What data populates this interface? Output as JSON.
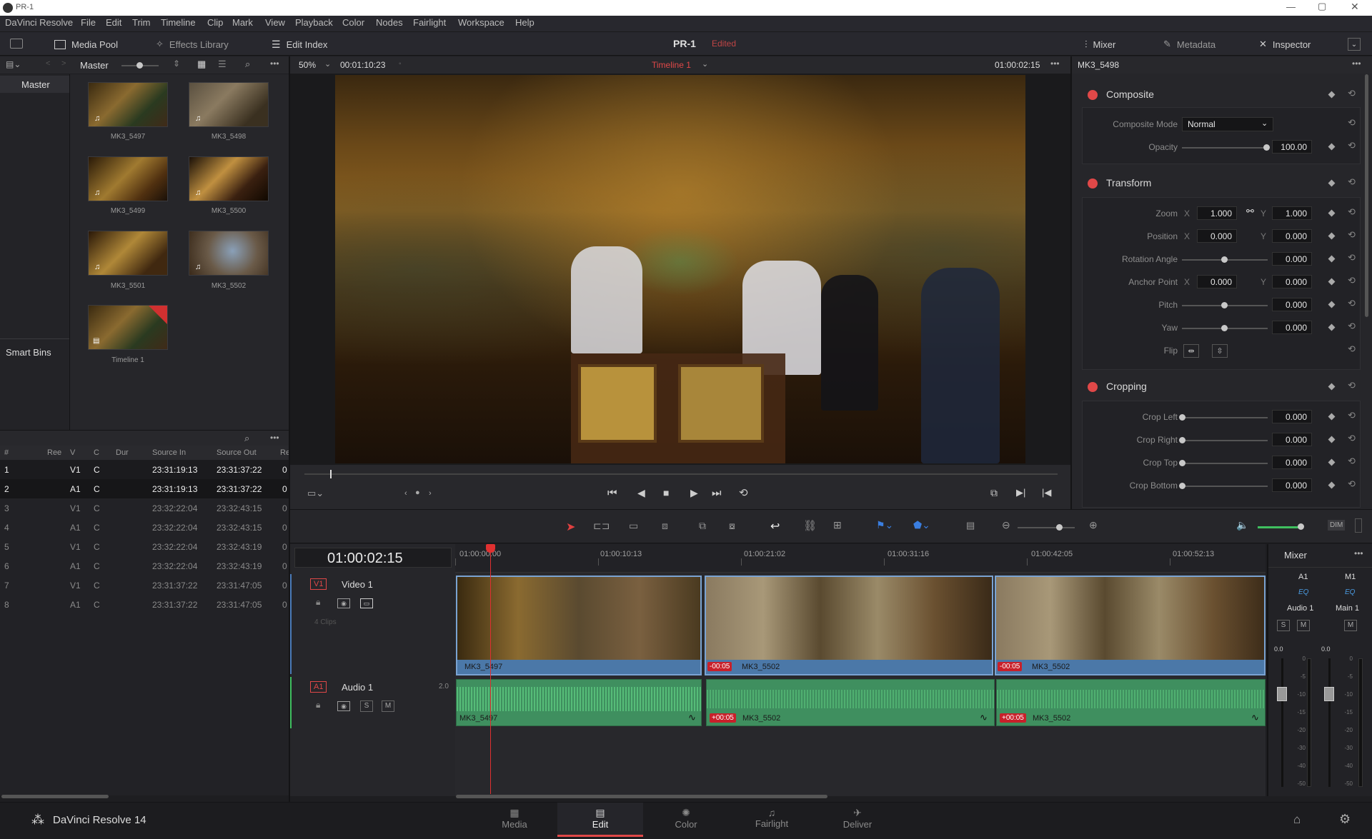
{
  "window": {
    "title": "PR-1"
  },
  "menu": [
    "DaVinci Resolve",
    "File",
    "Edit",
    "Trim",
    "Timeline",
    "Clip",
    "Mark",
    "View",
    "Playback",
    "Color",
    "Nodes",
    "Fairlight",
    "Workspace",
    "Help"
  ],
  "toolbar": {
    "media_pool": "Media Pool",
    "effects_library": "Effects Library",
    "edit_index": "Edit Index",
    "project_name": "PR-1",
    "edited": "Edited",
    "mixer": "Mixer",
    "metadata": "Metadata",
    "inspector": "Inspector"
  },
  "media_pool": {
    "bin_name": "Master",
    "sidebar_master": "Master",
    "smart_bins": "Smart Bins",
    "clips": [
      {
        "name": "MK3_5497"
      },
      {
        "name": "MK3_5498"
      },
      {
        "name": "MK3_5499"
      },
      {
        "name": "MK3_5500"
      },
      {
        "name": "MK3_5501"
      },
      {
        "name": "MK3_5502"
      },
      {
        "name": "Timeline 1"
      }
    ]
  },
  "viewer": {
    "zoom": "50%",
    "duration": "00:01:10:23",
    "timeline_name": "Timeline 1",
    "timecode": "01:00:02:15"
  },
  "edit_index": {
    "columns": [
      "#",
      "Ree",
      "V",
      "C",
      "Dur",
      "Source In",
      "Source Out",
      "Re"
    ],
    "rows": [
      {
        "n": "1",
        "v": "V1",
        "c": "C",
        "in": "23:31:19:13",
        "out": "23:31:37:22",
        "re": "0"
      },
      {
        "n": "2",
        "v": "A1",
        "c": "C",
        "in": "23:31:19:13",
        "out": "23:31:37:22",
        "re": "0"
      },
      {
        "n": "3",
        "v": "V1",
        "c": "C",
        "in": "23:32:22:04",
        "out": "23:32:43:15",
        "re": "0"
      },
      {
        "n": "4",
        "v": "A1",
        "c": "C",
        "in": "23:32:22:04",
        "out": "23:32:43:15",
        "re": "0"
      },
      {
        "n": "5",
        "v": "V1",
        "c": "C",
        "in": "23:32:22:04",
        "out": "23:32:43:19",
        "re": "0"
      },
      {
        "n": "6",
        "v": "A1",
        "c": "C",
        "in": "23:32:22:04",
        "out": "23:32:43:19",
        "re": "0"
      },
      {
        "n": "7",
        "v": "V1",
        "c": "C",
        "in": "23:31:37:22",
        "out": "23:31:47:05",
        "re": "0"
      },
      {
        "n": "8",
        "v": "A1",
        "c": "C",
        "in": "23:31:37:22",
        "out": "23:31:47:05",
        "re": "0"
      }
    ]
  },
  "inspector": {
    "clip_name": "MK3_5498",
    "composite": {
      "title": "Composite",
      "mode_label": "Composite Mode",
      "mode": "Normal",
      "opacity_label": "Opacity",
      "opacity": "100.00"
    },
    "transform": {
      "title": "Transform",
      "zoom_label": "Zoom",
      "zoom_x": "1.000",
      "zoom_y": "1.000",
      "position_label": "Position",
      "pos_x": "0.000",
      "pos_y": "0.000",
      "rotation_label": "Rotation Angle",
      "rotation": "0.000",
      "anchor_label": "Anchor Point",
      "anchor_x": "0.000",
      "anchor_y": "0.000",
      "pitch_label": "Pitch",
      "pitch": "0.000",
      "yaw_label": "Yaw",
      "yaw": "0.000",
      "flip_label": "Flip",
      "x": "X",
      "y": "Y"
    },
    "cropping": {
      "title": "Cropping",
      "left_label": "Crop Left",
      "left": "0.000",
      "right_label": "Crop Right",
      "right": "0.000",
      "top_label": "Crop Top",
      "top": "0.000",
      "bottom_label": "Crop Bottom",
      "bottom": "0.000"
    }
  },
  "timeline": {
    "timecode": "01:00:02:15",
    "ruler": [
      "01:00:00:00",
      "01:00:10:13",
      "01:00:21:02",
      "01:00:31:16",
      "01:00:42:05",
      "01:00:52:13"
    ],
    "video_track": {
      "id": "V1",
      "name": "Video 1",
      "clips_count": "4 Clips"
    },
    "audio_track": {
      "id": "A1",
      "name": "Audio 1",
      "channels": "2.0"
    },
    "clips": [
      {
        "name": "MK3_5497",
        "badge": ""
      },
      {
        "name": "MK3_5502",
        "badge": "-00:05"
      },
      {
        "name": "MK3_5502",
        "badge": "-00:05"
      }
    ],
    "audio_clips": [
      {
        "name": "MK3_5497",
        "badge": ""
      },
      {
        "name": "MK3_5502",
        "badge": "+00:05"
      },
      {
        "name": "MK3_5502",
        "badge": "+00:05"
      }
    ]
  },
  "mixer": {
    "title": "Mixer",
    "channels": [
      {
        "id": "A1",
        "eq": "EQ",
        "name": "Audio 1",
        "level": "0.0"
      },
      {
        "id": "M1",
        "eq": "EQ",
        "name": "Main 1",
        "level": "0.0"
      }
    ],
    "scale": [
      "0",
      "-5",
      "-10",
      "-15",
      "-20",
      "-30",
      "-40",
      "-50"
    ],
    "dim": "DIM",
    "s": "S",
    "m": "M"
  },
  "pages": {
    "brand": "DaVinci Resolve 14",
    "tabs": [
      "Media",
      "Edit",
      "Color",
      "Fairlight",
      "Deliver"
    ]
  },
  "colors": {
    "accent_red": "#e04848",
    "video_clip": "#4b78a8",
    "audio_clip": "#3f8f5f",
    "playhead": "#e03030"
  }
}
